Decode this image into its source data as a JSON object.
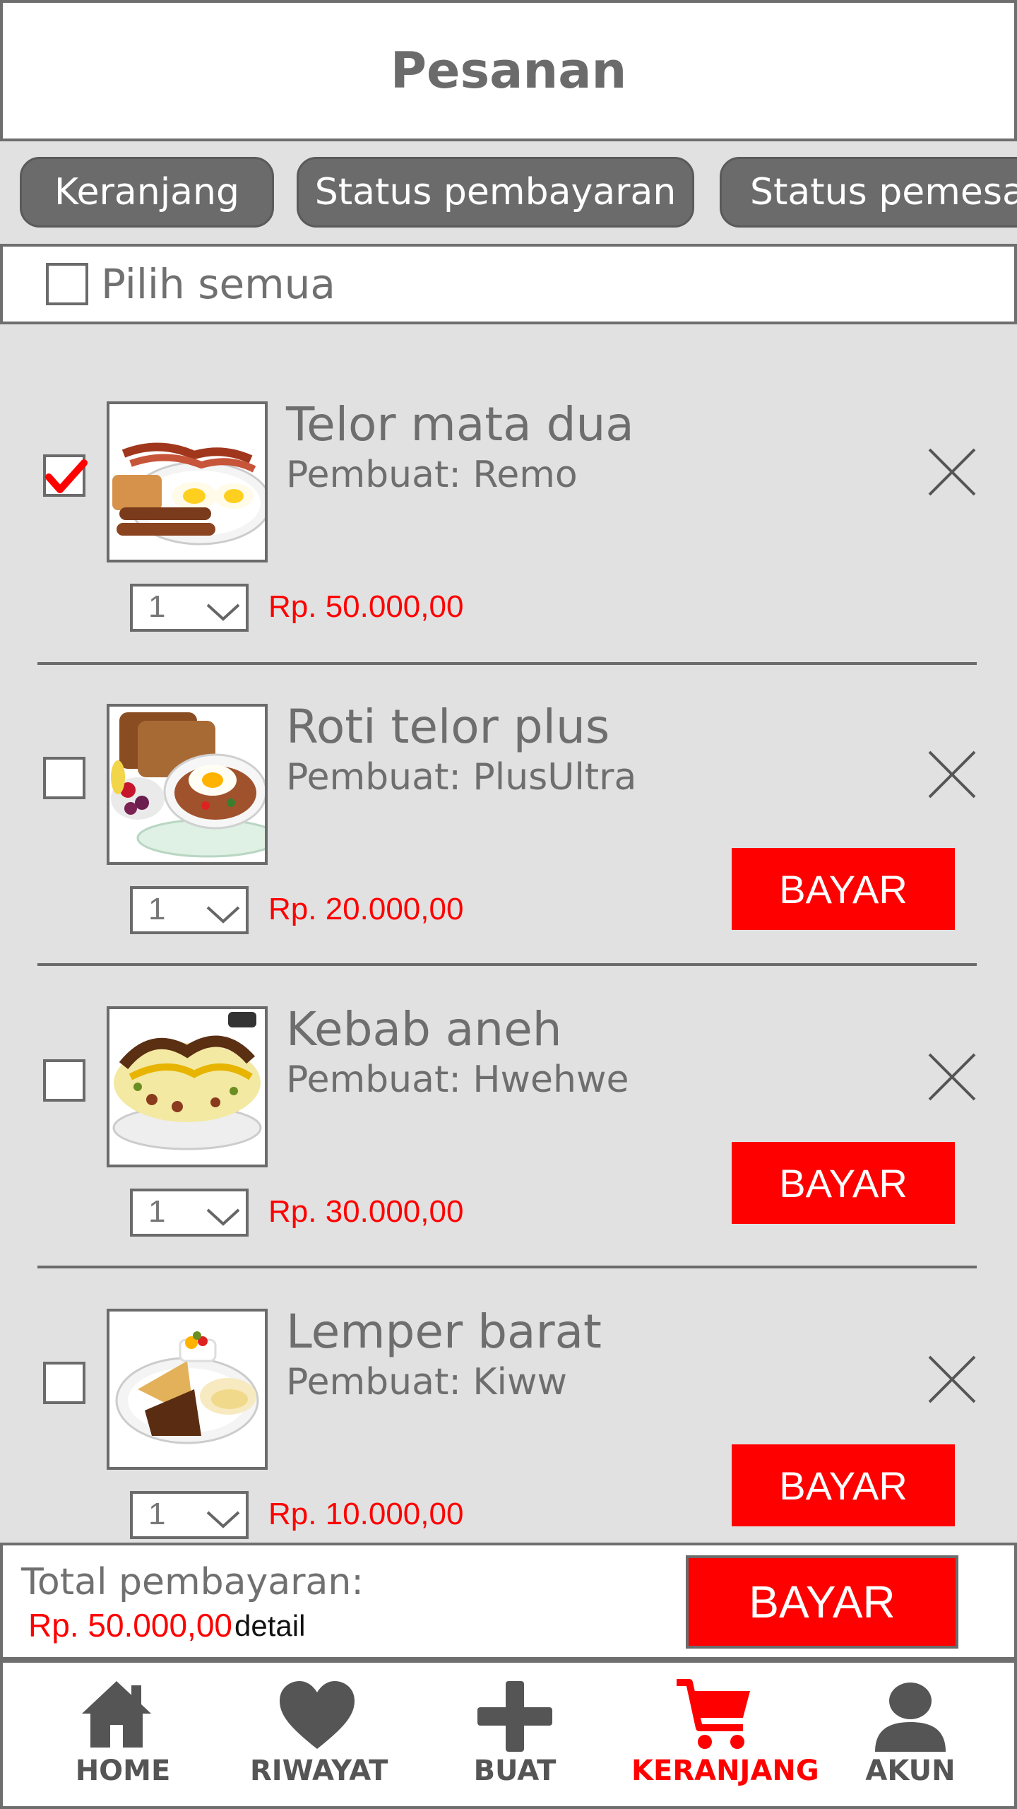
{
  "header": {
    "title": "Pesanan"
  },
  "tabs": [
    {
      "label": "Keranjang",
      "active": true
    },
    {
      "label": "Status pembayaran",
      "active": false
    },
    {
      "label": "Status pemesan",
      "active": false
    }
  ],
  "select_all": {
    "label": "Pilih semua",
    "checked": false
  },
  "items": [
    {
      "name": "Telor mata dua",
      "maker": "Pembuat: Remo",
      "qty": "1",
      "price": "Rp. 50.000,00",
      "checked": true,
      "pay_label": "",
      "image": "breakfast-bacon-eggs-sausage"
    },
    {
      "name": "Roti telor plus",
      "maker": "Pembuat: PlusUltra",
      "qty": "1",
      "price": "Rp. 20.000,00",
      "checked": false,
      "pay_label": "BAYAR",
      "image": "toast-egg-fruit"
    },
    {
      "name": "Kebab aneh",
      "maker": "Pembuat: Hwehwe",
      "qty": "1",
      "price": "Rp. 30.000,00",
      "checked": false,
      "pay_label": "BAYAR",
      "image": "omelette-cheese"
    },
    {
      "name": "Lemper barat",
      "maker": "Pembuat: Kiww",
      "qty": "1",
      "price": "Rp. 10.000,00",
      "checked": false,
      "pay_label": "BAYAR",
      "image": "crepe-plate"
    }
  ],
  "footer": {
    "total_label": "Total pembayaran:",
    "total_value": "Rp. 50.000,00",
    "detail_label": "detail",
    "pay_label": "BAYAR"
  },
  "nav": [
    {
      "label": "HOME",
      "icon": "home-icon",
      "active": false
    },
    {
      "label": "RIWAYAT",
      "icon": "heart-icon",
      "active": false
    },
    {
      "label": "BUAT",
      "icon": "plus-icon",
      "active": false
    },
    {
      "label": "KERANJANG",
      "icon": "cart-icon",
      "active": true
    },
    {
      "label": "AKUN",
      "icon": "user-icon",
      "active": false
    }
  ],
  "colors": {
    "accent": "#ff0000",
    "gray": "#6b6b6b",
    "background": "#e1e1e1"
  }
}
